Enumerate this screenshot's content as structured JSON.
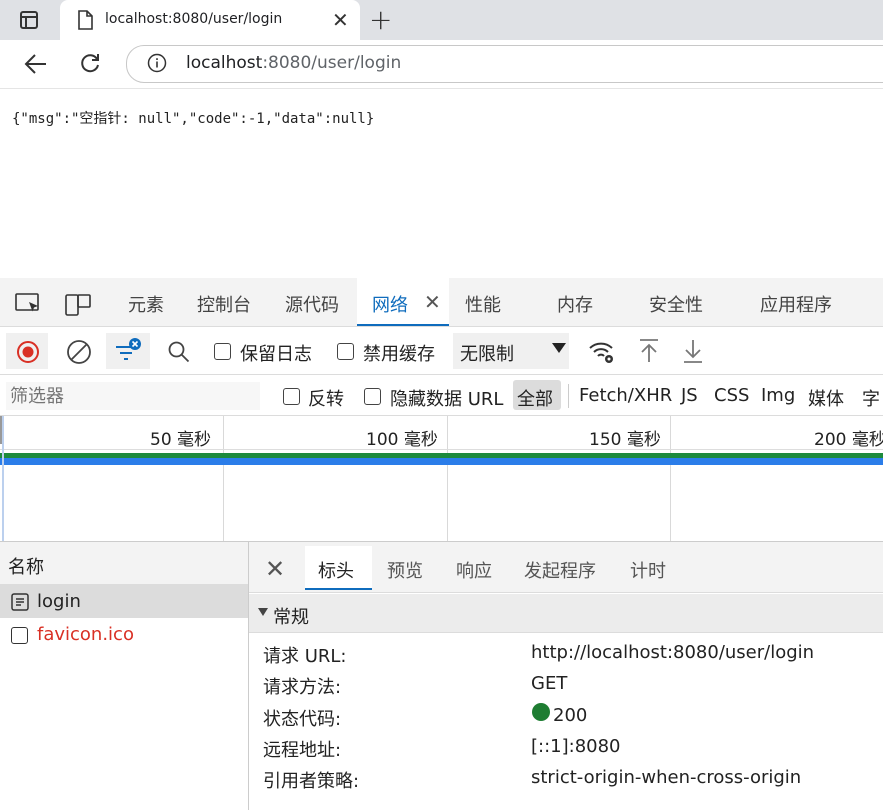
{
  "browser": {
    "tab_title": "localhost:8080/user/login",
    "url_host": "localhost",
    "url_rest": ":8080/user/login"
  },
  "page": {
    "json_text": "{\"msg\":\"空指针: null\",\"code\":-1,\"data\":null}"
  },
  "devtools": {
    "tabs": [
      "元素",
      "控制台",
      "源代码",
      "网络",
      "性能",
      "内存",
      "安全性",
      "应用程序"
    ],
    "toolbar": {
      "preserve_log": "保留日志",
      "disable_cache": "禁用缓存",
      "throttling": "无限制"
    },
    "filter": {
      "placeholder": "筛选器",
      "invert": "反转",
      "hide_data_urls": "隐藏数据 URL",
      "types": [
        "全部",
        "Fetch/XHR",
        "JS",
        "CSS",
        "Img",
        "媒体",
        "字"
      ]
    },
    "timeline_ticks": [
      "50 毫秒",
      "100 毫秒",
      "150 毫秒",
      "200 毫秒"
    ],
    "request_list": {
      "header": "名称",
      "items": [
        {
          "name": "login",
          "status": "ok"
        },
        {
          "name": "favicon.ico",
          "status": "error"
        }
      ]
    },
    "details": {
      "tabs": [
        "标头",
        "预览",
        "响应",
        "发起程序",
        "计时"
      ],
      "section_title": "常规",
      "rows": [
        {
          "key": "请求 URL:",
          "value": "http://localhost:8080/user/login"
        },
        {
          "key": "请求方法:",
          "value": "GET"
        },
        {
          "key": "状态代码:",
          "value": "200"
        },
        {
          "key": "远程地址:",
          "value": "[::1]:8080"
        },
        {
          "key": "引用者策略:",
          "value": "strict-origin-when-cross-origin"
        }
      ]
    }
  },
  "colors": {
    "accent": "#0f6cbd",
    "record_red": "#d93025",
    "status_green": "#1e7d32",
    "error_text": "#d93025"
  }
}
